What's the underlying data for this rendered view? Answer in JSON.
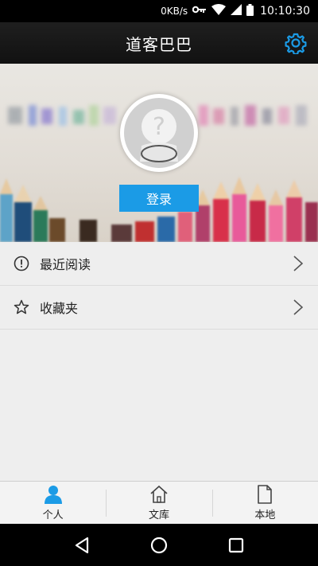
{
  "status_bar": {
    "network_speed": "0KB/s",
    "time": "10:10:30",
    "icons": [
      "vpn-key-icon",
      "wifi-icon",
      "signal-icon",
      "battery-icon"
    ]
  },
  "header": {
    "title": "道客巴巴",
    "settings_icon": "gear-icon",
    "accent_color": "#1b9be6"
  },
  "profile": {
    "avatar_icon": "unknown-user-icon",
    "login_label": "登录"
  },
  "menu": {
    "items": [
      {
        "label": "最近阅读",
        "icon": "info-circle-icon"
      },
      {
        "label": "收藏夹",
        "icon": "star-icon"
      }
    ]
  },
  "tabs": [
    {
      "label": "个人",
      "icon": "person-icon",
      "active": true
    },
    {
      "label": "文库",
      "icon": "house-icon",
      "active": false
    },
    {
      "label": "本地",
      "icon": "document-icon",
      "active": false
    }
  ],
  "navigation": {
    "icons": [
      "back-icon",
      "home-icon",
      "recents-icon"
    ]
  }
}
